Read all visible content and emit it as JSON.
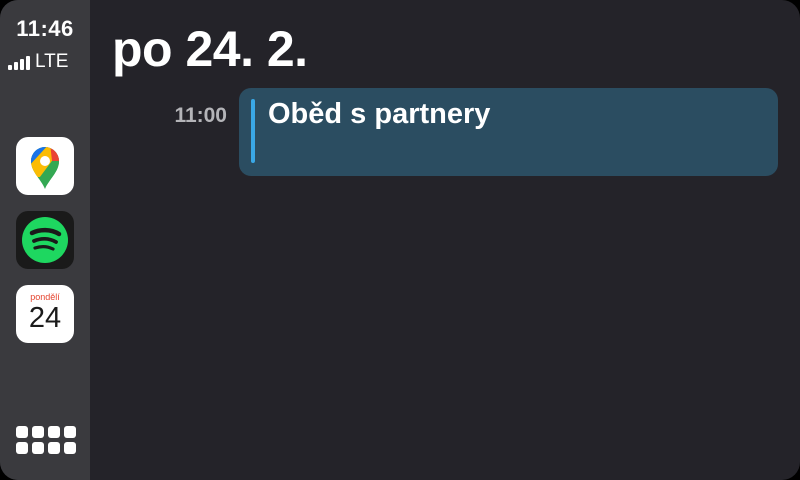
{
  "status_bar": {
    "time": "11:46",
    "network": "LTE",
    "signal_bars": 4
  },
  "dock": {
    "apps": [
      {
        "name": "Google Maps",
        "icon": "google-maps-icon"
      },
      {
        "name": "Spotify",
        "icon": "spotify-icon",
        "color": "#1ed760"
      },
      {
        "name": "Calendar",
        "icon": "calendar-icon",
        "weekday": "pondělí",
        "day": "24"
      }
    ],
    "app_grid_icon": "app-grid-icon"
  },
  "calendar": {
    "date_heading": "po 24. 2.",
    "events": [
      {
        "time": "11:00",
        "title": "Oběd s partnery",
        "accent_color": "#3aa8e6",
        "card_color": "#2b4d61"
      }
    ]
  }
}
